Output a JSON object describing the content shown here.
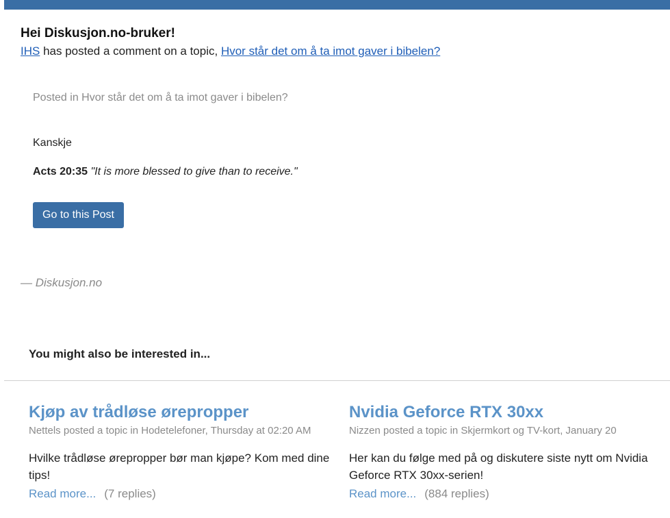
{
  "greeting": "Hei Diskusjon.no-bruker!",
  "notice": {
    "user": "IHS",
    "middle_text": " has posted a comment on a topic, ",
    "topic": "Hvor står det om å ta imot gaver i bibelen?"
  },
  "post": {
    "context": "Posted in Hvor står det om å ta imot gaver i bibelen?",
    "body_line1": "Kanskje",
    "ref": "Acts 20:35",
    "quote": "\"It is more blessed to give than to receive.\"",
    "button_label": "Go to this Post"
  },
  "signature": "— Diskusjon.no",
  "interest_heading": "You might also be interested in...",
  "cards": [
    {
      "title": "Kjøp av trådløse ørepropper",
      "meta": "Nettels posted a topic in Hodetelefoner, Thursday at 02:20 AM",
      "description": "Hvilke trådløse ørepropper bør man kjøpe? Kom med dine tips!",
      "read_more": "Read more...",
      "replies": "(7 replies)"
    },
    {
      "title": "Nvidia Geforce RTX 30xx",
      "meta": "Nizzen posted a topic in Skjermkort og TV-kort, January 20",
      "description": "Her kan du følge med på og diskutere siste nytt om Nvidia Geforce RTX 30xx-serien!",
      "read_more": "Read more...",
      "replies": "(884 replies)"
    }
  ],
  "colors": {
    "accent": "#3a6ea5",
    "link": "#1f5eb7",
    "card_title": "#5b93c8",
    "muted": "#8a8a8a"
  }
}
